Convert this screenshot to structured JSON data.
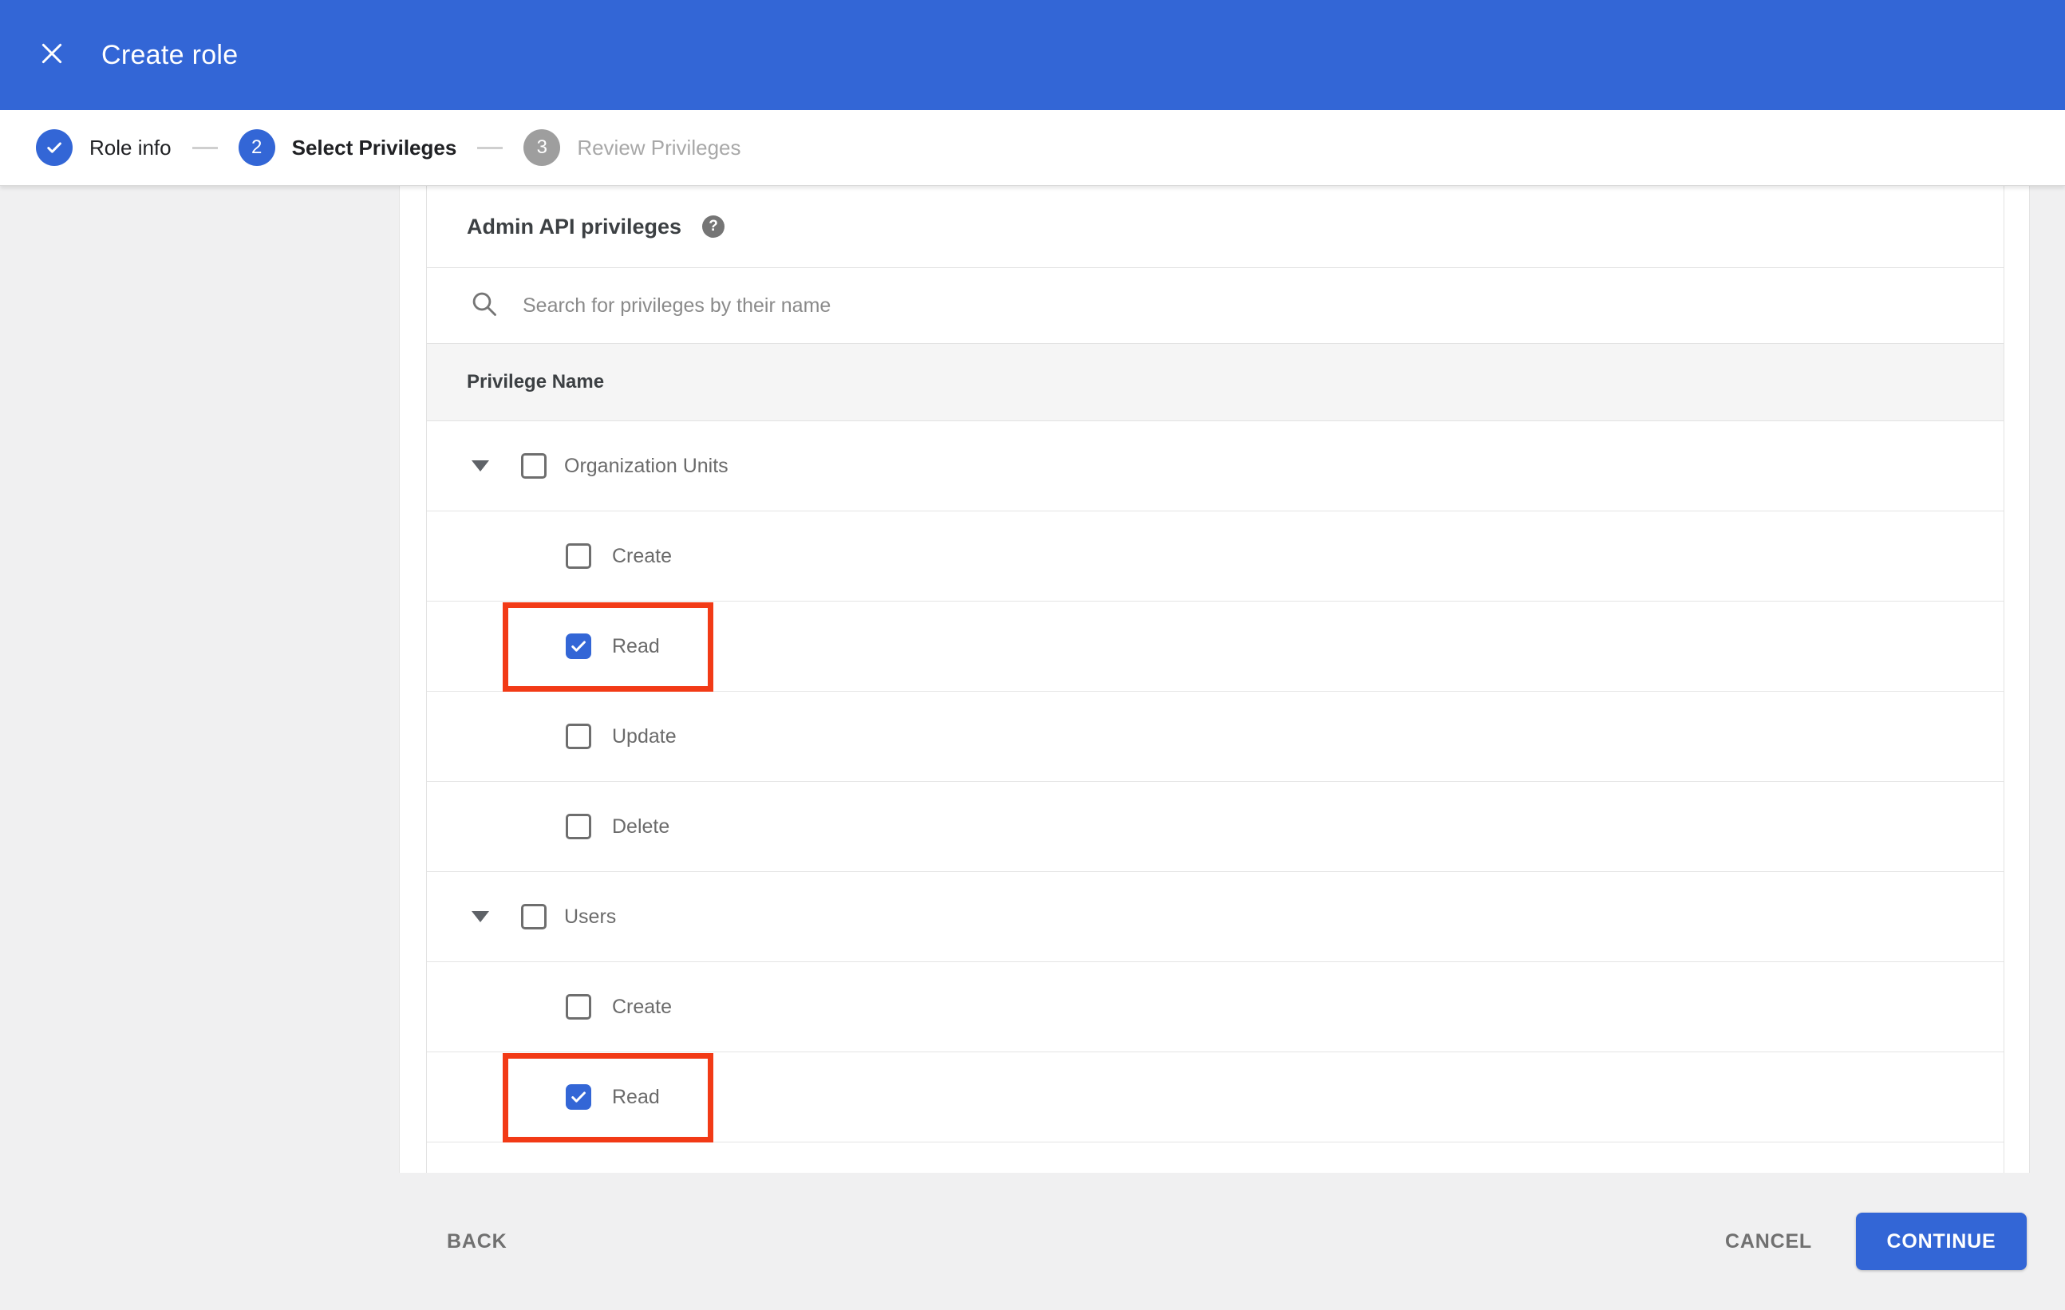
{
  "titlebar": {
    "title": "Create role",
    "close_icon": "close-icon",
    "bg_color": "#3366d6"
  },
  "stepper": {
    "steps": [
      {
        "label": "Role info",
        "state": "complete",
        "icon": "check-icon"
      },
      {
        "label": "Select Privileges",
        "state": "active",
        "number": "2"
      },
      {
        "label": "Review Privileges",
        "state": "upcoming",
        "number": "3"
      }
    ]
  },
  "content": {
    "heading": "Admin API privileges",
    "help_icon": "help-icon",
    "search_icon": "search-icon",
    "search_placeholder": "Search for privileges by their name",
    "table_header": "Privilege Name",
    "rows": [
      {
        "type": "group",
        "label": "Organization Units",
        "checked": false,
        "expanded": true,
        "highlighted": false
      },
      {
        "type": "child",
        "label": "Create",
        "checked": false,
        "highlighted": false
      },
      {
        "type": "child",
        "label": "Read",
        "checked": true,
        "highlighted": true
      },
      {
        "type": "child",
        "label": "Update",
        "checked": false,
        "highlighted": false
      },
      {
        "type": "child",
        "label": "Delete",
        "checked": false,
        "highlighted": false
      },
      {
        "type": "group",
        "label": "Users",
        "checked": false,
        "expanded": true,
        "highlighted": false
      },
      {
        "type": "child",
        "label": "Create",
        "checked": false,
        "highlighted": false
      },
      {
        "type": "child",
        "label": "Read",
        "checked": true,
        "highlighted": true
      }
    ]
  },
  "footer": {
    "back_label": "BACK",
    "cancel_label": "CANCEL",
    "continue_label": "CONTINUE"
  },
  "colors": {
    "primary_blue": "#3366d6",
    "highlight_red": "#f23a16",
    "page_bg": "#f0f0f1",
    "table_header_bg": "#f5f5f5",
    "divider": "#e2e2e2",
    "checkbox_border": "#6e6e6e"
  }
}
